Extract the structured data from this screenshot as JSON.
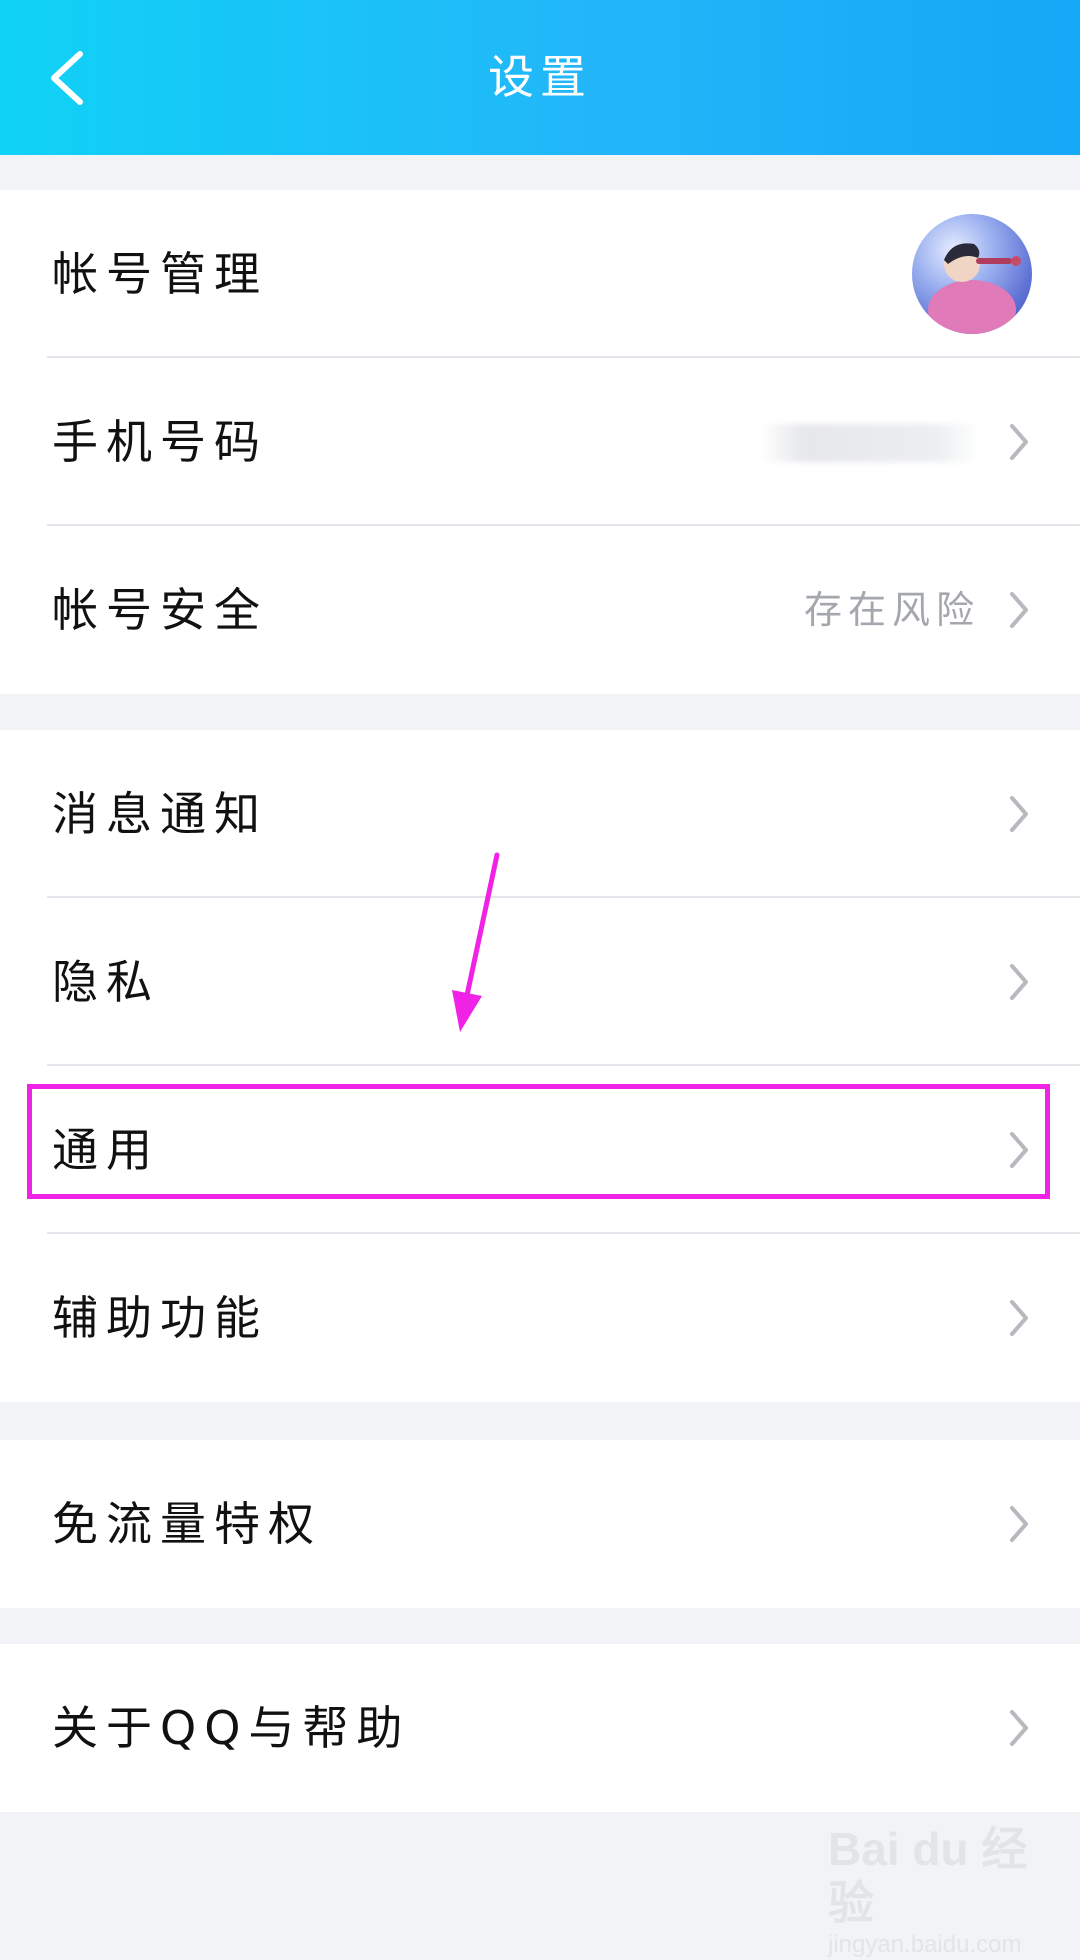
{
  "header": {
    "title": "设置",
    "back_icon": "chevron-left-icon"
  },
  "groups": [
    {
      "items": [
        {
          "label": "帐号管理",
          "value": "",
          "trailing": "avatar"
        },
        {
          "label": "手机号码",
          "value": "",
          "trailing": "chevron-right-icon"
        },
        {
          "label": "帐号安全",
          "value": "存在风险",
          "trailing": "chevron-right-icon"
        }
      ]
    },
    {
      "items": [
        {
          "label": "消息通知",
          "trailing": "chevron-right-icon"
        },
        {
          "label": "隐私",
          "trailing": "chevron-right-icon"
        },
        {
          "label": "通用",
          "trailing": "chevron-right-icon",
          "highlighted": true
        },
        {
          "label": "辅助功能",
          "trailing": "chevron-right-icon"
        }
      ]
    },
    {
      "items": [
        {
          "label": "免流量特权",
          "trailing": "chevron-right-icon"
        }
      ]
    },
    {
      "items": [
        {
          "label": "关于QQ与帮助",
          "trailing": "chevron-right-icon"
        }
      ]
    }
  ],
  "annotation": {
    "highlight_color": "#f022e6",
    "arrow_color": "#f022e6"
  },
  "watermark": {
    "brand": "Bai du 经验",
    "url": "jingyan.baidu.com"
  },
  "colors": {
    "header_start": "#10d2f6",
    "header_end": "#14a8f6",
    "background": "#f2f3f7"
  }
}
